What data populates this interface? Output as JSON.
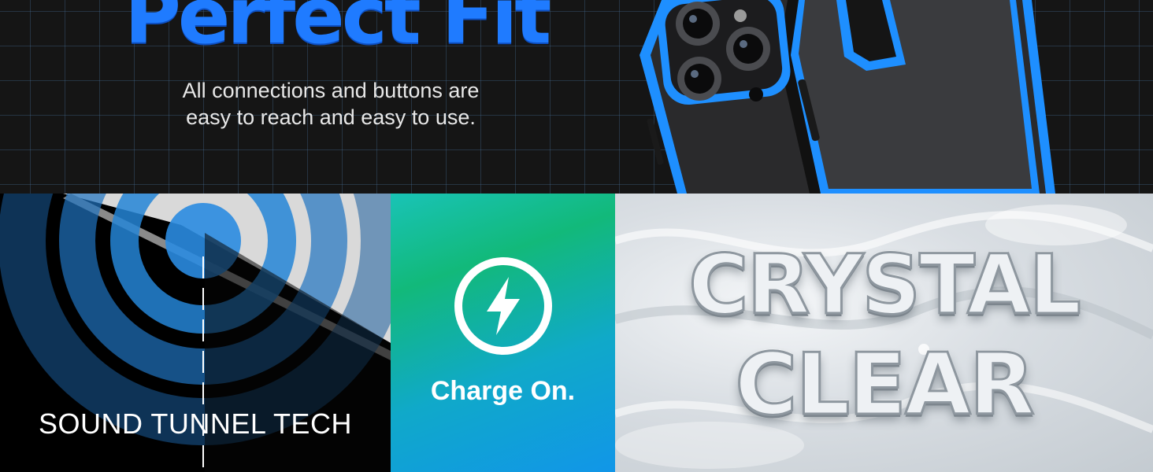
{
  "banner": {
    "headline": "Perfect Fit",
    "subtext_line1": "All connections and buttons are",
    "subtext_line2": "easy to reach and easy to use."
  },
  "sound": {
    "caption": "SOUND TUNNEL TECH"
  },
  "charge": {
    "label": "Charge On.",
    "icon": "lightning-bolt-icon"
  },
  "crystal": {
    "line1": "CRYSTAL",
    "line2": "CLEAR"
  },
  "colors": {
    "headline_blue": "#1f7bff",
    "case_blue": "#1e8fff",
    "charge_green": "#12b97a",
    "charge_blue": "#1196e8"
  }
}
